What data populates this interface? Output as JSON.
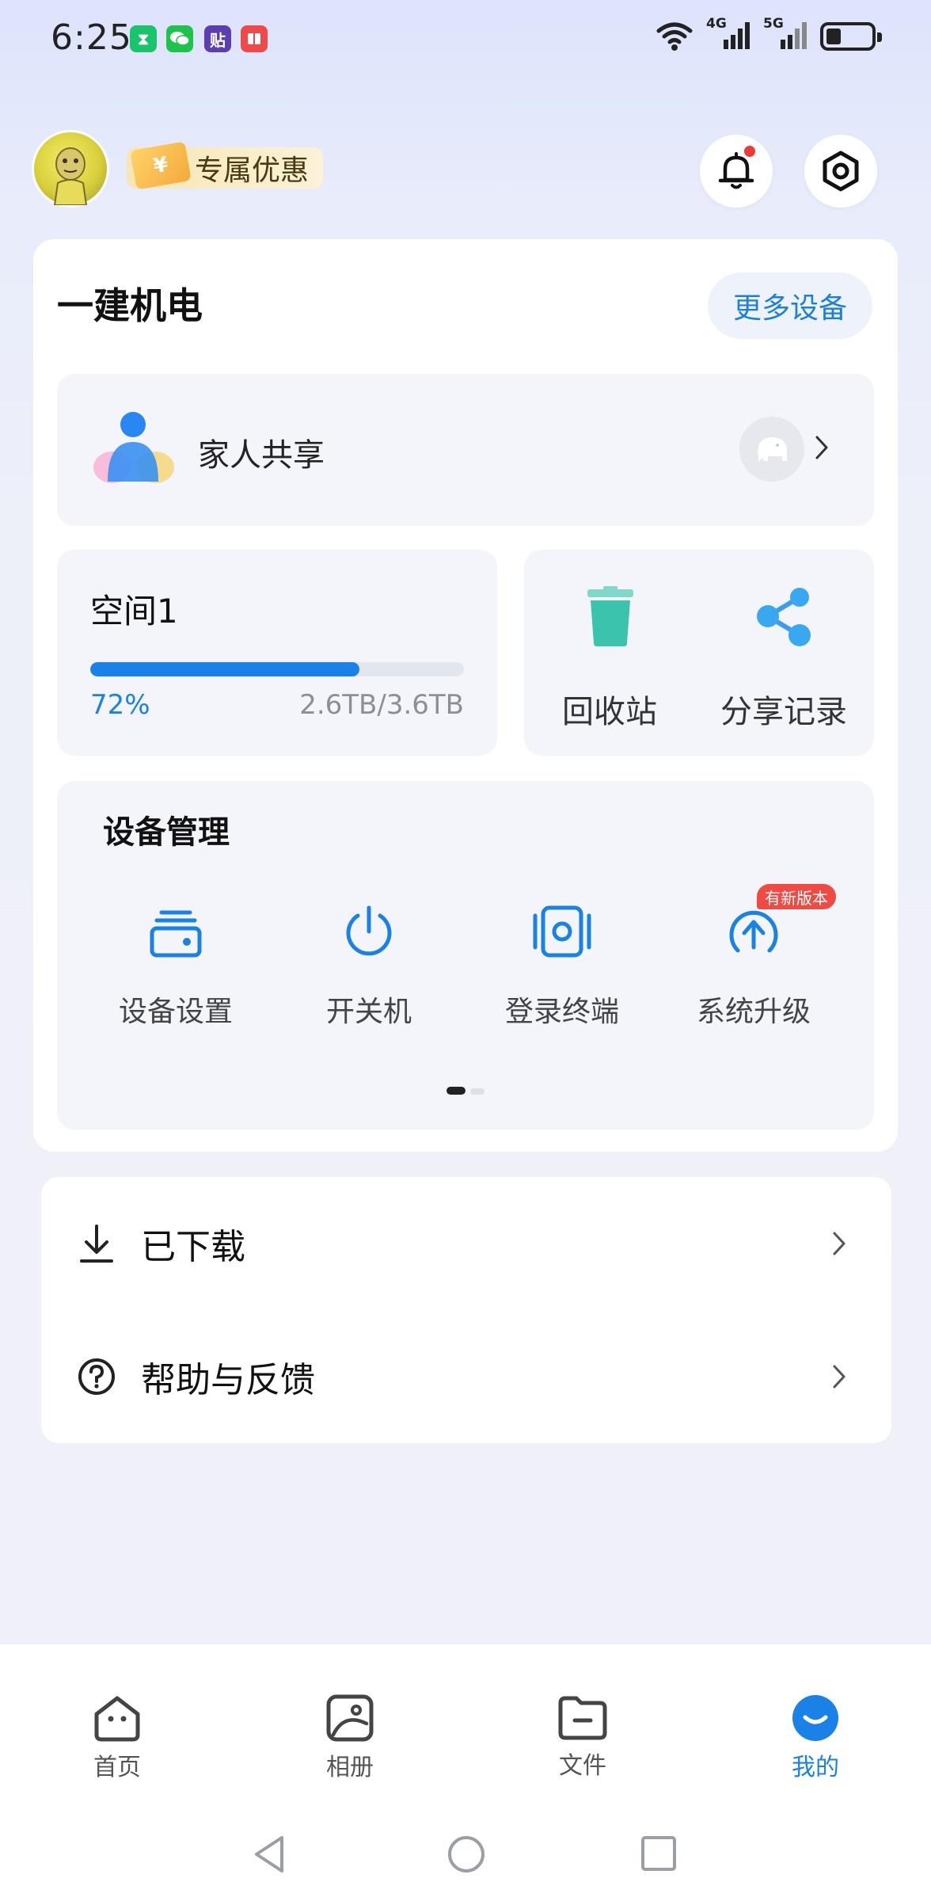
{
  "status_bar": {
    "time": "6:25",
    "network_labels": [
      "4G",
      "5G"
    ]
  },
  "header": {
    "promo_label": "专属优惠",
    "promo_ticket_symbol": "¥",
    "notification_dot_color": "#f03a36"
  },
  "device": {
    "name": "一建机电",
    "more_label": "更多设备"
  },
  "family": {
    "label": "家人共享"
  },
  "space": {
    "title": "空间1",
    "used_fraction": 0.72,
    "percent_label": "72%",
    "size_label": "2.6TB/3.6TB"
  },
  "tools": [
    {
      "label": "回收站",
      "icon": "trash-icon"
    },
    {
      "label": "分享记录",
      "icon": "share-icon"
    }
  ],
  "management": {
    "title": "设备管理",
    "items": [
      {
        "label": "设备设置",
        "icon": "device-settings-icon"
      },
      {
        "label": "开关机",
        "icon": "power-icon"
      },
      {
        "label": "登录终端",
        "icon": "terminal-icon"
      },
      {
        "label": "系统升级",
        "icon": "upgrade-icon"
      }
    ],
    "badge": "有新版本",
    "page_count": 2,
    "current_page": 1
  },
  "list": [
    {
      "label": "已下载",
      "icon": "download-icon"
    },
    {
      "label": "帮助与反馈",
      "icon": "help-icon"
    }
  ],
  "nav": {
    "items": [
      {
        "label": "首页",
        "icon": "home-icon"
      },
      {
        "label": "相册",
        "icon": "album-icon"
      },
      {
        "label": "文件",
        "icon": "folder-icon"
      },
      {
        "label": "我的",
        "icon": "profile-icon"
      }
    ],
    "active_index": 3
  },
  "colors": {
    "accent": "#1a82e6",
    "badge": "#f04a42"
  }
}
